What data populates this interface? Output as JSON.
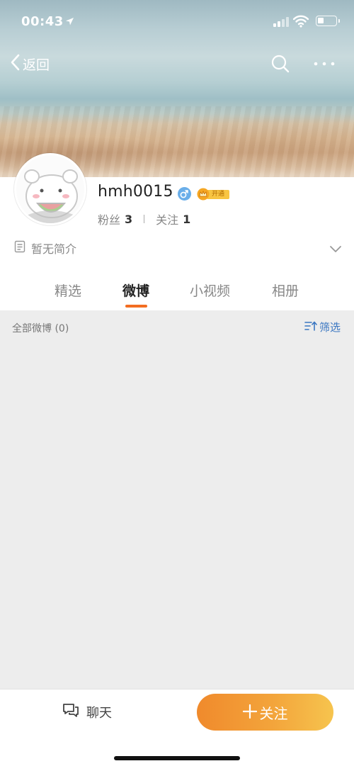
{
  "status_bar": {
    "time": "00:43"
  },
  "nav": {
    "back_label": "返回"
  },
  "profile": {
    "username": "hmh0015",
    "vip_label": "开通",
    "fans_label": "粉丝",
    "fans_count": "3",
    "following_label": "关注",
    "following_count": "1",
    "bio": "暂无简介"
  },
  "tabs": [
    {
      "label": "精选"
    },
    {
      "label": "微博"
    },
    {
      "label": "小视频"
    },
    {
      "label": "相册"
    }
  ],
  "active_tab": "微博",
  "filter_bar": {
    "count_label": "全部微博 (0)",
    "filter_label": "筛选"
  },
  "bottom_bar": {
    "chat_label": "聊天",
    "follow_label": "关注"
  },
  "colors": {
    "accent": "#f36d21",
    "link": "#3a76c1",
    "follow_start": "#f08a2c",
    "follow_end": "#f6c44e",
    "gender": "#6aaee9"
  },
  "icons": [
    "location-arrow-icon",
    "signal-icon",
    "wifi-icon",
    "battery-icon",
    "back-chevron-icon",
    "search-icon",
    "more-icon",
    "male-icon",
    "crown-icon",
    "document-icon",
    "chevron-down-icon",
    "filter-sort-icon",
    "chat-icon",
    "plus-icon"
  ]
}
